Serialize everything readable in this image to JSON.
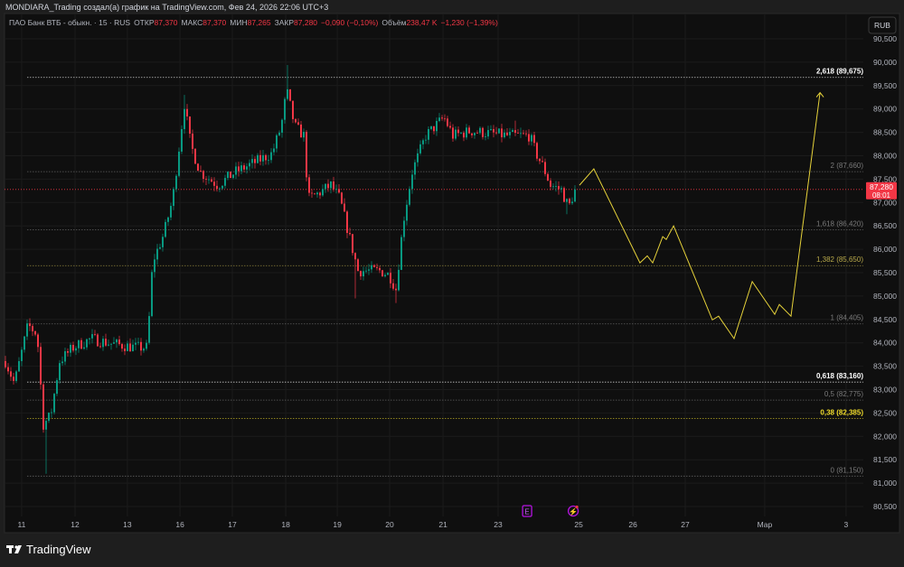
{
  "header": {
    "title": "MONDIARA_Trading создал(а) график на TradingView.com, Фев 24, 2026 22:06 UTC+3"
  },
  "legend": {
    "symbol": "ПАО Банк ВТБ - обыкн. · 15 · RUS",
    "open_label": "ОТКР",
    "open": "87,370",
    "high_label": "МАКС",
    "high": "87,370",
    "low_label": "МИН",
    "low": "87,265",
    "close_label": "ЗАКР",
    "close": "87,280",
    "change": "−0,090 (−0,10%)",
    "volume_label": "Объём",
    "volume": "238,47 K",
    "volume_change": "−1,230 (−1,39%)"
  },
  "currency_button": "RUB",
  "brand": "TradingView",
  "colors": {
    "up": "#089981",
    "down": "#f23645",
    "projection": "#e6d23a",
    "bg": "#0f0f0f"
  },
  "chart_data": {
    "type": "candlestick",
    "x_unit": "bar index (15-min bars)",
    "ylim": [
      80300,
      90800
    ],
    "xlim": [
      0,
      316.7
    ],
    "price_ticks": [
      "90,500",
      "90,000",
      "89,500",
      "89,000",
      "88,500",
      "88,000",
      "87,500",
      "87,000",
      "86,500",
      "86,000",
      "85,500",
      "85,000",
      "84,500",
      "84,000",
      "83,500",
      "83,000",
      "82,500",
      "82,000",
      "81,500",
      "81,000",
      "80,500"
    ],
    "price_tick_values": [
      90500,
      90000,
      89500,
      89000,
      88500,
      88000,
      87500,
      87000,
      86500,
      86000,
      85500,
      85000,
      84500,
      84000,
      83500,
      83000,
      82500,
      82000,
      81500,
      81000,
      80500
    ],
    "time_ticks": [
      {
        "label": "11",
        "bar": 6.3
      },
      {
        "label": "12",
        "bar": 26
      },
      {
        "label": "13",
        "bar": 45.3
      },
      {
        "label": "16",
        "bar": 64.7
      },
      {
        "label": "17",
        "bar": 84
      },
      {
        "label": "18",
        "bar": 103.7
      },
      {
        "label": "19",
        "bar": 122.7
      },
      {
        "label": "20",
        "bar": 142
      },
      {
        "label": "21",
        "bar": 161.7
      },
      {
        "label": "23",
        "bar": 182
      },
      {
        "label": "25",
        "bar": 211.7
      },
      {
        "label": "26",
        "bar": 231.7
      },
      {
        "label": "27",
        "bar": 251
      },
      {
        "label": "Мар",
        "bar": 280.3
      },
      {
        "label": "3",
        "bar": 310.3
      }
    ],
    "price_path": [
      [
        0,
        83610
      ],
      [
        3.3,
        83130
      ],
      [
        8.3,
        84380
      ],
      [
        11.7,
        84180
      ],
      [
        14,
        82260
      ],
      [
        16.7,
        82450
      ],
      [
        20,
        83610
      ],
      [
        25,
        83900
      ],
      [
        31.7,
        84090
      ],
      [
        38.3,
        83990
      ],
      [
        48.3,
        83900
      ],
      [
        52.3,
        83900
      ],
      [
        54.3,
        85730
      ],
      [
        58.3,
        86310
      ],
      [
        61.7,
        87080
      ],
      [
        66,
        89110
      ],
      [
        68.3,
        88240
      ],
      [
        71.7,
        87660
      ],
      [
        78.3,
        87370
      ],
      [
        85,
        87660
      ],
      [
        91.7,
        87850
      ],
      [
        98.3,
        88050
      ],
      [
        101.7,
        88630
      ],
      [
        103.7,
        89400
      ],
      [
        106.7,
        88630
      ],
      [
        110,
        88430
      ],
      [
        111.7,
        87080
      ],
      [
        115,
        87180
      ],
      [
        120,
        87370
      ],
      [
        123.3,
        87080
      ],
      [
        128.3,
        85930
      ],
      [
        130,
        85540
      ],
      [
        133.3,
        85540
      ],
      [
        138.3,
        85540
      ],
      [
        141.7,
        85440
      ],
      [
        144,
        85150
      ],
      [
        146.7,
        86600
      ],
      [
        150,
        87660
      ],
      [
        155,
        88430
      ],
      [
        161.7,
        88820
      ],
      [
        165,
        88430
      ],
      [
        171.7,
        88530
      ],
      [
        185,
        88430
      ],
      [
        193.3,
        88430
      ],
      [
        195.7,
        88050
      ],
      [
        198.3,
        87760
      ],
      [
        201,
        87370
      ],
      [
        205,
        87270
      ],
      [
        207.7,
        86890
      ],
      [
        210,
        87280
      ]
    ],
    "spikes": [
      [
        15,
        81200,
        "low"
      ],
      [
        103.7,
        89940,
        "high"
      ],
      [
        66.3,
        89300,
        "high"
      ],
      [
        144,
        84850,
        "low"
      ],
      [
        129,
        84950,
        "low"
      ],
      [
        207,
        86750,
        "low"
      ],
      [
        188,
        88750,
        "high"
      ]
    ],
    "last_price": {
      "value": 87280,
      "label": "87,280",
      "countdown": "08:01"
    },
    "fib_levels": [
      {
        "ratio": "2,618",
        "price": 89675,
        "label": "2,618 (89,675)",
        "color": "#ffffff",
        "bold": true
      },
      {
        "ratio": "2",
        "price": 87660,
        "label": "2 (87,660)",
        "color": "#7a7a7a",
        "bold": false
      },
      {
        "ratio": "1,618",
        "price": 86420,
        "label": "1,618 (86,420)",
        "color": "#7a7a7a",
        "bold": false
      },
      {
        "ratio": "1,382",
        "price": 85650,
        "label": "1,382 (85,650)",
        "color": "#b8a94a",
        "bold": false
      },
      {
        "ratio": "1",
        "price": 84405,
        "label": "1 (84,405)",
        "color": "#7a7a7a",
        "bold": false
      },
      {
        "ratio": "0,618",
        "price": 83160,
        "label": "0,618 (83,160)",
        "color": "#ffffff",
        "bold": true
      },
      {
        "ratio": "0,5",
        "price": 82775,
        "label": "0,5 (82,775)",
        "color": "#7a7a7a",
        "bold": false
      },
      {
        "ratio": "0,38",
        "price": 82385,
        "label": "0,38 (82,385)",
        "color": "#f0dc2a",
        "bold": true
      },
      {
        "ratio": "0",
        "price": 81150,
        "label": "0 (81,150)",
        "color": "#7a7a7a",
        "bold": false
      }
    ],
    "projection": [
      [
        212,
        87370
      ],
      [
        217.3,
        87720
      ],
      [
        234.3,
        85710
      ],
      [
        237,
        85860
      ],
      [
        239,
        85710
      ],
      [
        242.7,
        86270
      ],
      [
        244,
        86210
      ],
      [
        246.7,
        86500
      ],
      [
        261,
        84490
      ],
      [
        263.3,
        84570
      ],
      [
        269,
        84090
      ],
      [
        275.7,
        85310
      ],
      [
        284,
        84610
      ],
      [
        285.7,
        84820
      ],
      [
        290,
        84570
      ],
      [
        300.7,
        89350
      ]
    ],
    "events": [
      {
        "type": "earnings",
        "label": "E",
        "bar": 192.7
      },
      {
        "type": "dividend",
        "label": "⚡",
        "bar": 209.7
      }
    ]
  }
}
